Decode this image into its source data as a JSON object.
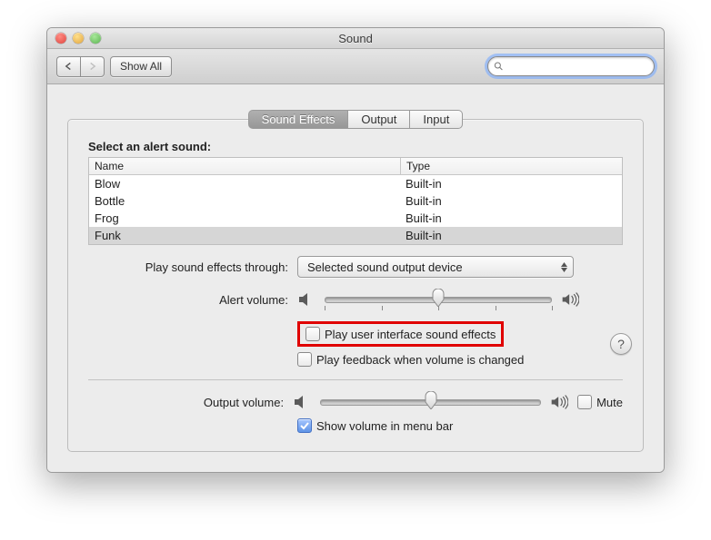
{
  "window": {
    "title": "Sound"
  },
  "toolbar": {
    "show_all": "Show All",
    "search_placeholder": ""
  },
  "tabs": {
    "sound_effects": "Sound Effects",
    "output": "Output",
    "input": "Input"
  },
  "alerts": {
    "section_label": "Select an alert sound:",
    "col_name": "Name",
    "col_type": "Type",
    "rows": [
      {
        "name": "Blow",
        "type": "Built-in"
      },
      {
        "name": "Bottle",
        "type": "Built-in"
      },
      {
        "name": "Frog",
        "type": "Built-in"
      },
      {
        "name": "Funk",
        "type": "Built-in"
      }
    ]
  },
  "play_through": {
    "label": "Play sound effects through:",
    "value": "Selected sound output device"
  },
  "alert_volume": {
    "label": "Alert volume:",
    "position_pct": 50
  },
  "checks": {
    "ui_sounds": "Play user interface sound effects",
    "feedback": "Play feedback when volume is changed"
  },
  "output_volume": {
    "label": "Output volume:",
    "position_pct": 50,
    "mute_label": "Mute"
  },
  "show_volume_menu": "Show volume in menu bar",
  "help": "?"
}
